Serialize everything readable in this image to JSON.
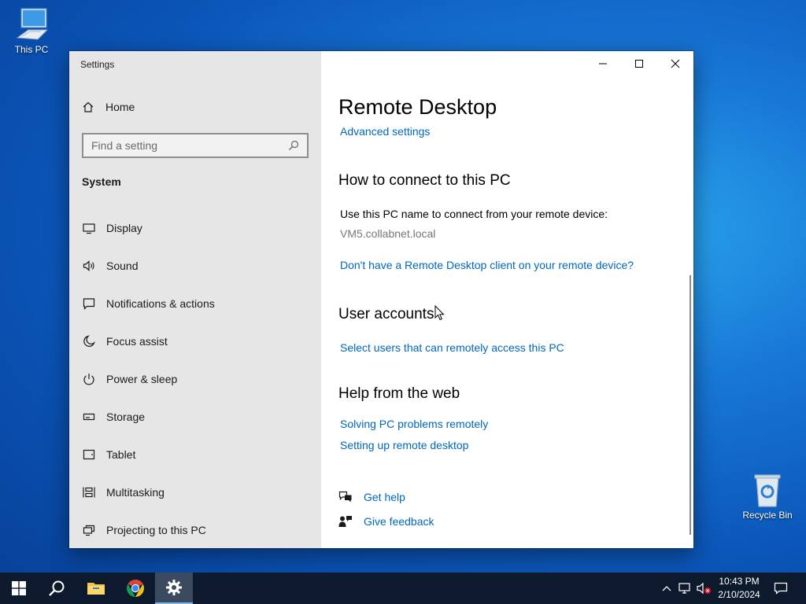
{
  "desktop": {
    "this_pc_label": "This PC",
    "recycle_bin_label": "Recycle Bin"
  },
  "window": {
    "title": "Settings"
  },
  "sidebar": {
    "home_label": "Home",
    "search_placeholder": "Find a setting",
    "section_title": "System",
    "items": [
      {
        "label": "Display",
        "icon": "display-icon"
      },
      {
        "label": "Sound",
        "icon": "speaker-icon"
      },
      {
        "label": "Notifications & actions",
        "icon": "notifications-icon"
      },
      {
        "label": "Focus assist",
        "icon": "moon-icon"
      },
      {
        "label": "Power & sleep",
        "icon": "power-icon"
      },
      {
        "label": "Storage",
        "icon": "storage-icon"
      },
      {
        "label": "Tablet",
        "icon": "tablet-icon"
      },
      {
        "label": "Multitasking",
        "icon": "multitasking-icon"
      },
      {
        "label": "Projecting to this PC",
        "icon": "projecting-icon"
      }
    ]
  },
  "content": {
    "page_title": "Remote Desktop",
    "advanced_settings_link": "Advanced settings",
    "connect_heading": "How to connect to this PC",
    "connect_description": "Use this PC name to connect from your remote device:",
    "pc_name": "VM5.collabnet.local",
    "no_client_link": "Don't have a Remote Desktop client on your remote device?",
    "user_accounts_heading": "User accounts",
    "select_users_link": "Select users that can remotely access this PC",
    "help_heading": "Help from the web",
    "help_links": [
      "Solving PC problems remotely",
      "Setting up remote desktop"
    ],
    "get_help_label": "Get help",
    "give_feedback_label": "Give feedback"
  },
  "taskbar": {
    "time": "10:43 PM",
    "date": "2/10/2024"
  },
  "colors": {
    "accent_link": "#0067b8",
    "sidebar_bg": "#e6e6e6",
    "taskbar_bg": "#0d1a2d"
  }
}
